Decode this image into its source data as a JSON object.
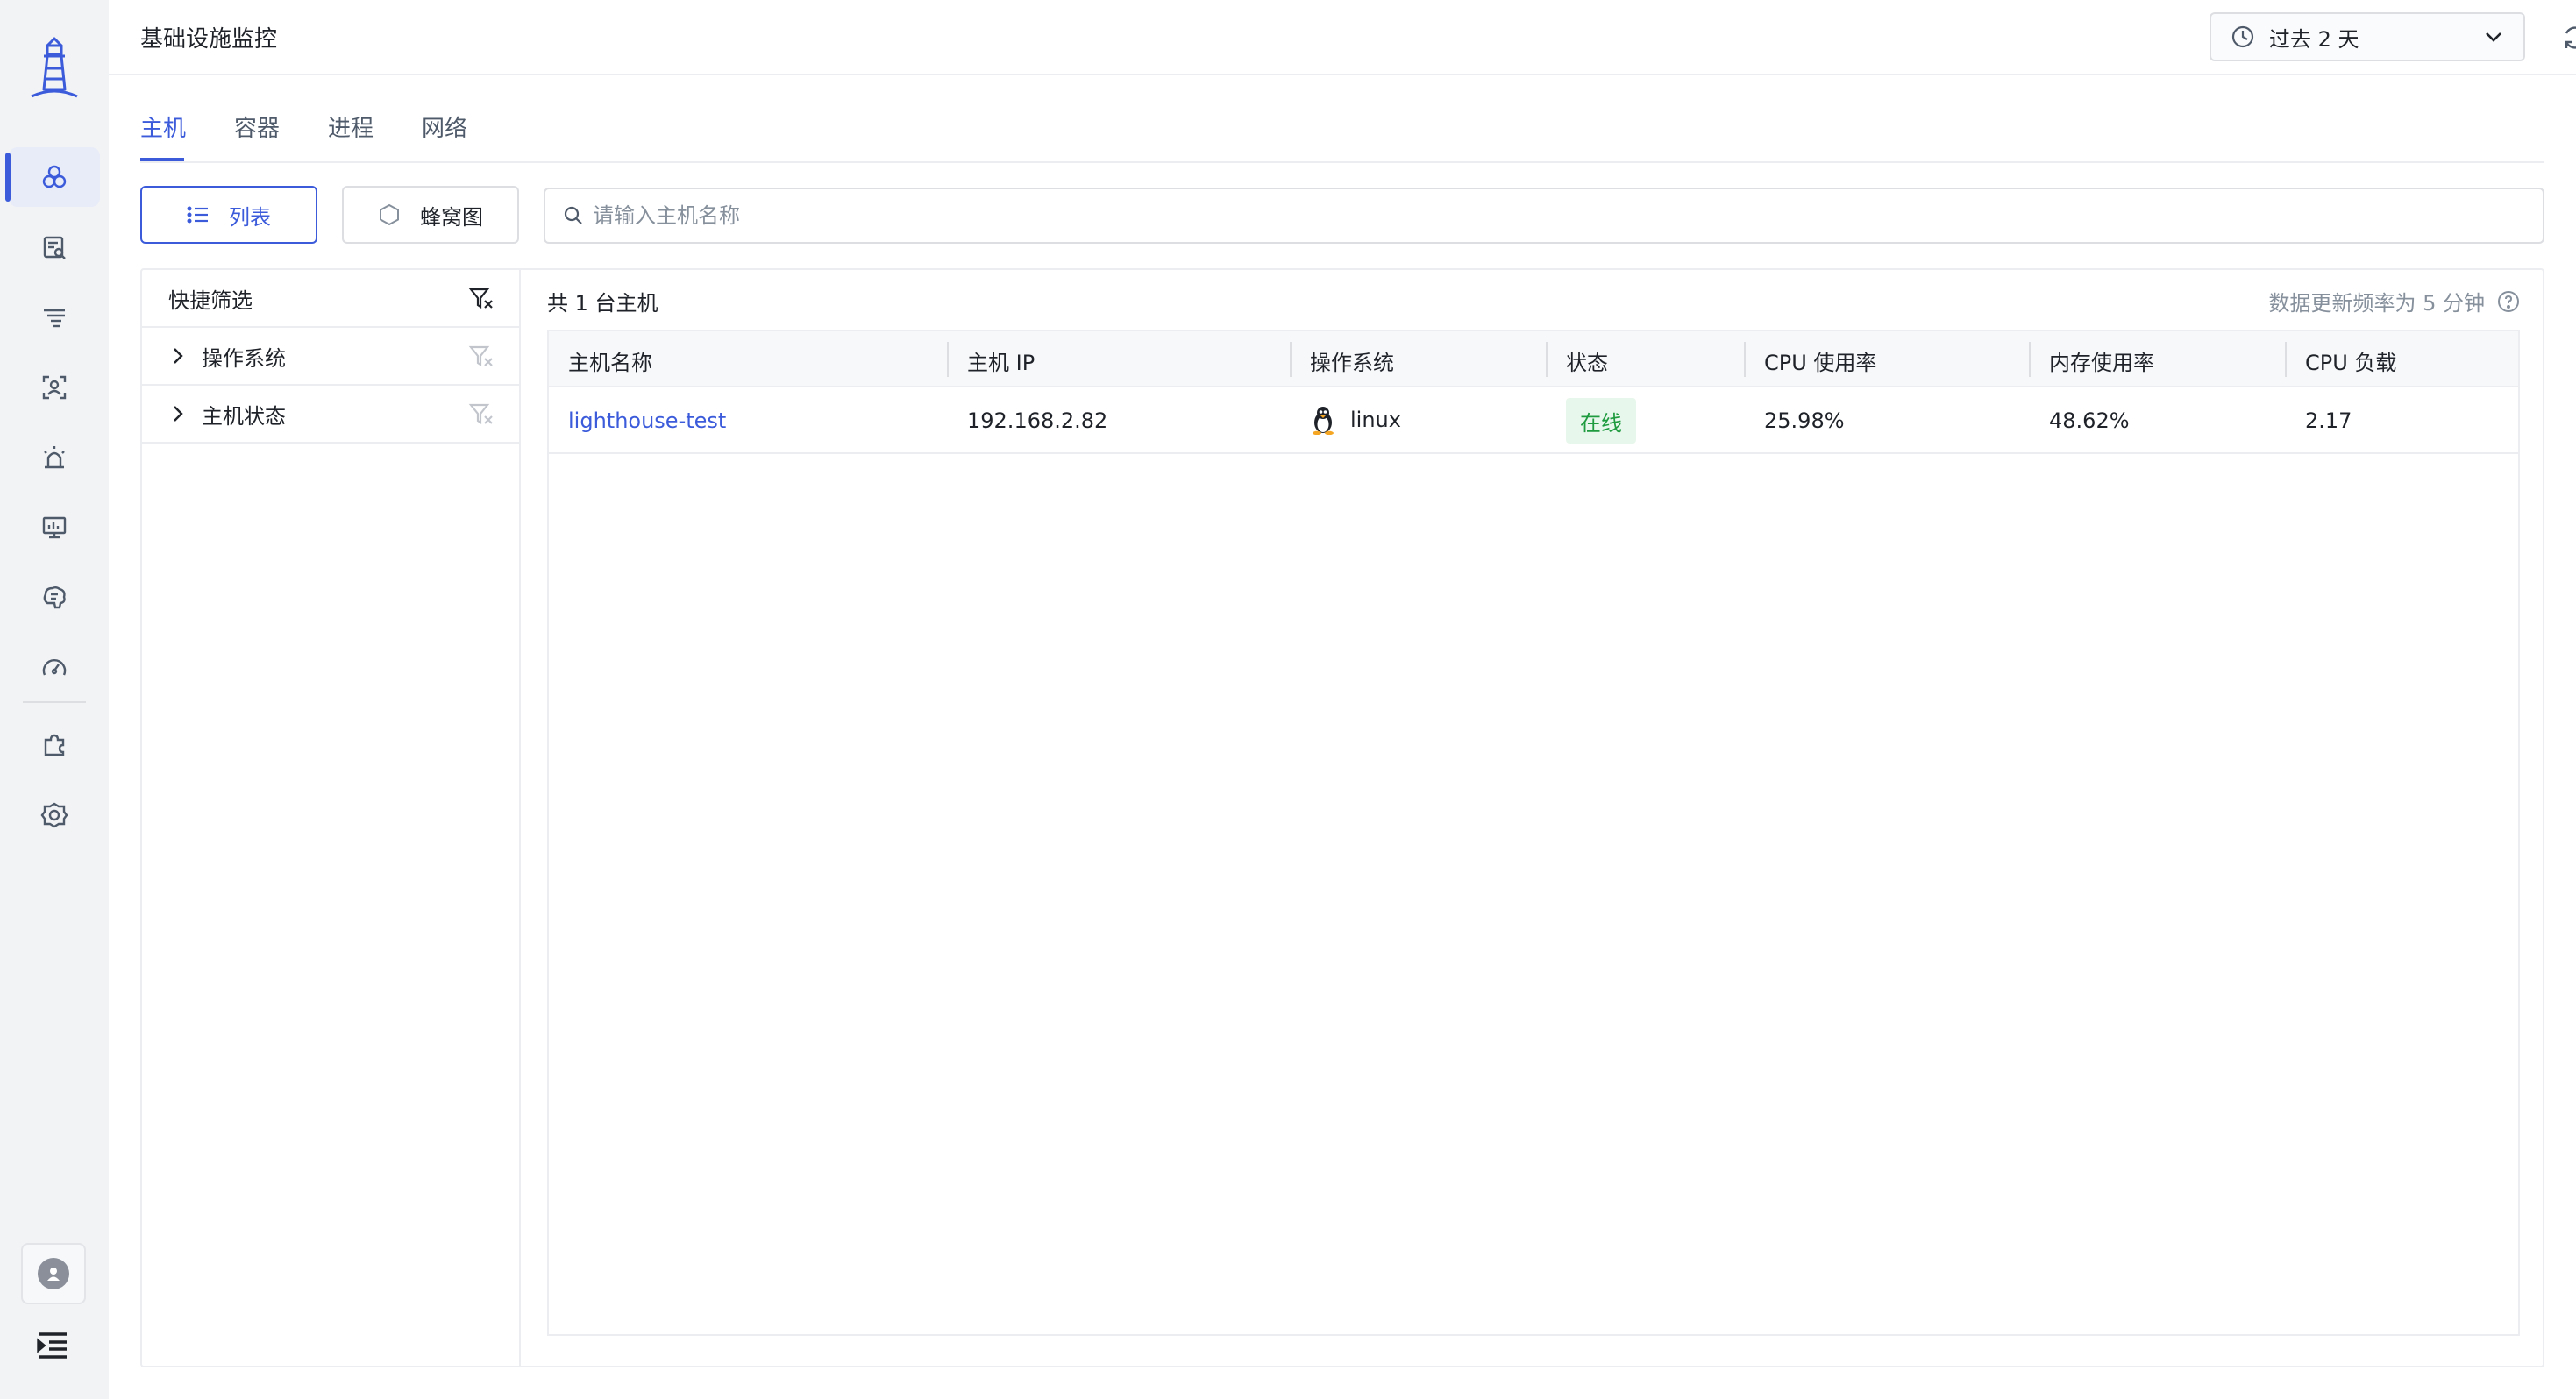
{
  "header": {
    "title": "基础设施监控",
    "time_range": "过去 2 天"
  },
  "tabs": [
    {
      "label": "主机",
      "active": true
    },
    {
      "label": "容器",
      "active": false
    },
    {
      "label": "进程",
      "active": false
    },
    {
      "label": "网络",
      "active": false
    }
  ],
  "view": {
    "list_label": "列表",
    "honeycomb_label": "蜂窝图"
  },
  "search": {
    "placeholder": "请输入主机名称",
    "value": ""
  },
  "filters": {
    "title": "快捷筛选",
    "items": [
      {
        "label": "操作系统"
      },
      {
        "label": "主机状态"
      }
    ]
  },
  "summary": {
    "count_text": "共 1 台主机",
    "refresh_note": "数据更新频率为 5 分钟"
  },
  "table": {
    "columns": [
      "主机名称",
      "主机 IP",
      "操作系统",
      "状态",
      "CPU 使用率",
      "内存使用率",
      "CPU 负载"
    ],
    "rows": [
      {
        "name": "lighthouse-test",
        "ip": "192.168.2.82",
        "os": "linux",
        "status": "在线",
        "cpu_usage": "25.98%",
        "mem_usage": "48.62%",
        "cpu_load": "2.17"
      }
    ]
  },
  "colors": {
    "accent": "#3b5bdb",
    "status_online_bg": "#e8f7ec",
    "status_online_text": "#1f9b3f",
    "sidebar_bg": "#f2f3f5"
  },
  "icons": {
    "sidebar": [
      "lighthouse-logo",
      "infrastructure-icon",
      "logs-icon",
      "filter-list-icon",
      "user-scan-icon",
      "alarm-icon",
      "dashboard-monitor-icon",
      "brain-icon",
      "gauge-icon",
      "puzzle-icon",
      "settings-icon",
      "avatar-icon",
      "collapse-menu-icon"
    ]
  }
}
